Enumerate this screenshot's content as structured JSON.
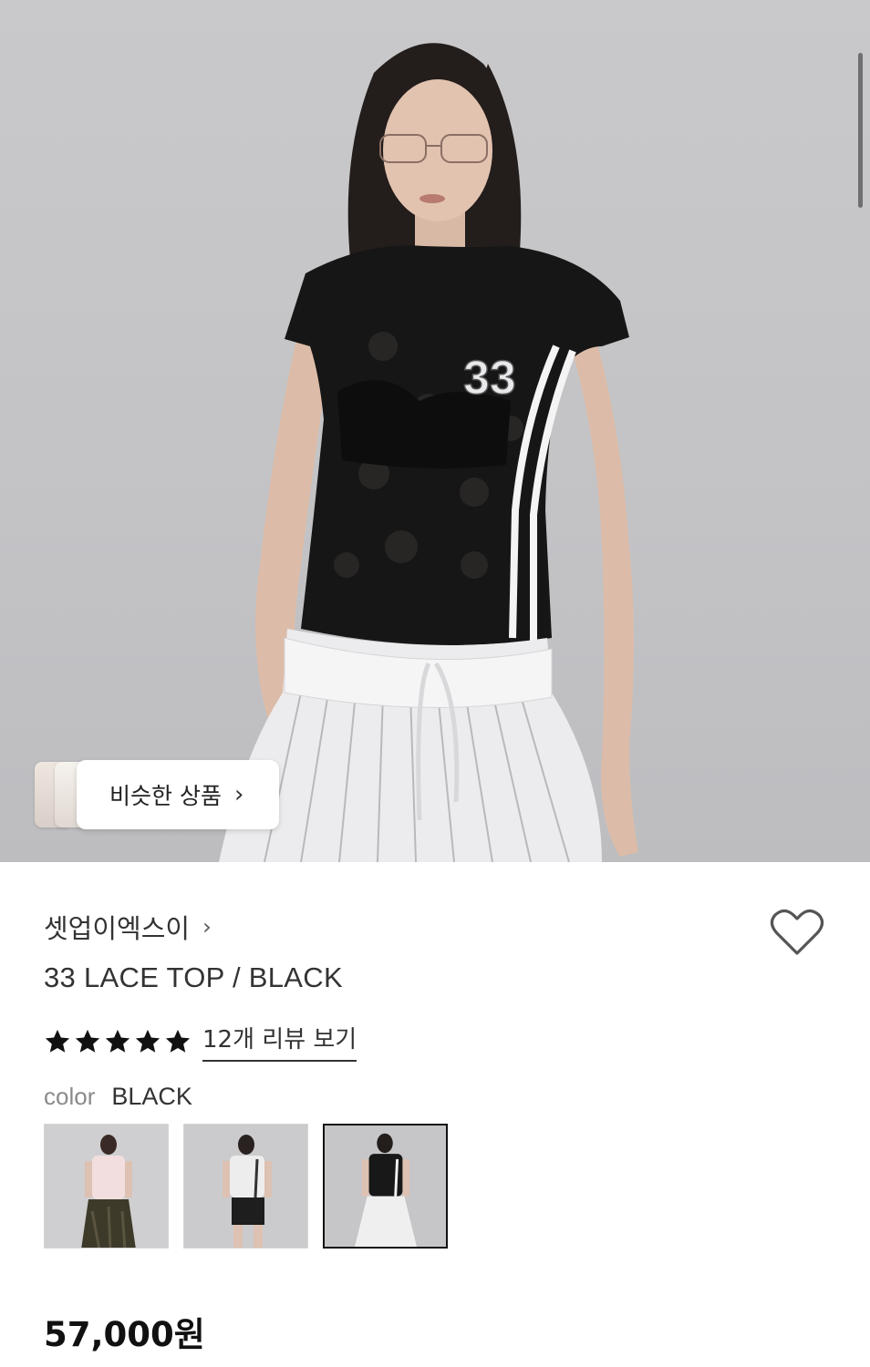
{
  "hero": {
    "similar_label": "비슷한 상품",
    "jersey_number": "33"
  },
  "product": {
    "brand": "셋업이엑스이",
    "title": "33 LACE TOP / BLACK",
    "rating_stars": 5,
    "review_link": "12개 리뷰 보기",
    "color_label": "color",
    "color_value": "BLACK",
    "price": "57,000원"
  },
  "colors": {
    "stars": "#111111",
    "selected_border": "#111111",
    "heart_stroke": "#555555"
  },
  "icons": {
    "brand_chevron": "chevron-right-icon",
    "similar_chevron": "chevron-right-icon",
    "wishlist": "heart-outline-icon",
    "star": "star-filled-icon"
  },
  "color_options": [
    {
      "name": "PINK",
      "selected": false
    },
    {
      "name": "WHITE",
      "selected": false
    },
    {
      "name": "BLACK",
      "selected": true
    }
  ]
}
